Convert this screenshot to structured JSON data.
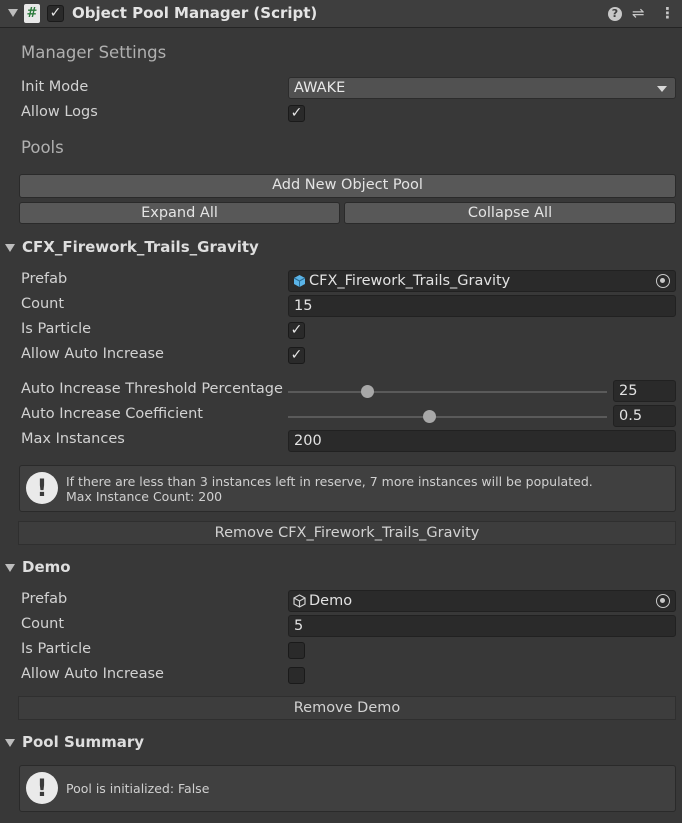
{
  "header": {
    "script_icon": "#",
    "enabled_check": "✓",
    "title": "Object Pool Manager (Script)",
    "icons": [
      "help-icon",
      "preset-icon",
      "more-icon"
    ],
    "help_glyph": "?",
    "preset_glyph": "⇌",
    "more_glyph": "⋮"
  },
  "manager_settings": {
    "section_title": "Manager Settings",
    "init_mode_label": "Init Mode",
    "init_mode_value": "AWAKE",
    "allow_logs_label": "Allow Logs",
    "allow_logs_check": "✓"
  },
  "pools": {
    "section_title": "Pools",
    "add_button": "Add New Object Pool",
    "expand_all": "Expand All",
    "collapse_all": "Collapse All"
  },
  "pool1": {
    "title": "CFX_Firework_Trails_Gravity",
    "prefab_label": "Prefab",
    "prefab_value": "CFX_Firework_Trails_Gravity",
    "count_label": "Count",
    "count_value": "15",
    "is_particle_label": "Is Particle",
    "is_particle_check": "✓",
    "auto_increase_label": "Allow Auto Increase",
    "auto_increase_check": "✓",
    "threshold_label": "Auto Increase Threshold Percentage",
    "threshold_value": "25",
    "threshold_fraction": 0.25,
    "coefficient_label": "Auto Increase Coefficient",
    "coefficient_value": "0.5",
    "coefficient_fraction": 0.445,
    "max_label": "Max Instances",
    "max_value": "200",
    "help_line1": "If there are less than 3 instances left in reserve, 7 more instances will be populated.",
    "help_line2": "Max Instance Count: 200",
    "remove_button": "Remove CFX_Firework_Trails_Gravity"
  },
  "pool2": {
    "title": "Demo",
    "prefab_label": "Prefab",
    "prefab_value": "Demo",
    "count_label": "Count",
    "count_value": "5",
    "is_particle_label": "Is Particle",
    "auto_increase_label": "Allow Auto Increase",
    "remove_button": "Remove Demo"
  },
  "summary": {
    "title": "Pool Summary",
    "help_text": "Pool is initialized: False"
  },
  "help_glyph": "!",
  "colors": {
    "background": "#383838",
    "field": "#2a2a2a",
    "button": "#585858",
    "prefab_icon": "#5ab4e8"
  }
}
